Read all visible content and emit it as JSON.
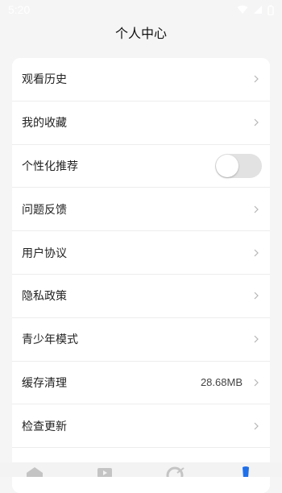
{
  "status": {
    "time": "5:20"
  },
  "header": {
    "title": "个人中心"
  },
  "menu": {
    "items": [
      {
        "label": "观看历史"
      },
      {
        "label": "我的收藏"
      },
      {
        "label": "个性化推荐",
        "toggle": false
      },
      {
        "label": "问题反馈"
      },
      {
        "label": "用户协议"
      },
      {
        "label": "隐私政策"
      },
      {
        "label": "青少年模式"
      },
      {
        "label": "缓存清理",
        "value": "28.68MB"
      },
      {
        "label": "检查更新"
      }
    ]
  },
  "colors": {
    "accent": "#1f6fe8",
    "toggle_off": "#e2e2e2"
  },
  "tabs": [
    {
      "icon": "home-icon"
    },
    {
      "icon": "video-icon"
    },
    {
      "icon": "discover-icon"
    },
    {
      "icon": "profile-icon",
      "active": true
    }
  ]
}
